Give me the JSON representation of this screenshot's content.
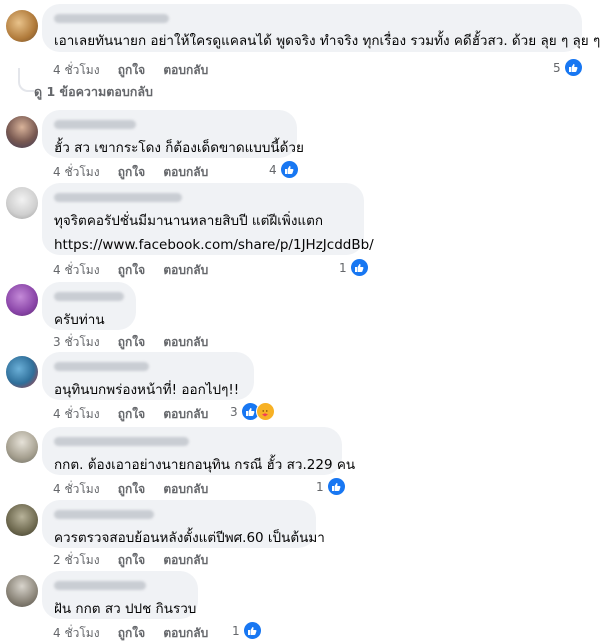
{
  "actions": {
    "like": "ถูกใจ",
    "reply": "ตอบกลับ"
  },
  "colors": {
    "like_blue": "#1877f2",
    "muted": "#65676b",
    "bubble": "#f0f2f5"
  },
  "first": {
    "text": "เอาเลยทันนายก อย่าให้ใครดูแคลนได้ พูดจริง ทำจริง ทุกเรื่อง รวมทั้ง คดีฮั้วสว. ด้วย ลุย ๆ ลุย ๆ",
    "time": "4 ชั่วโมง",
    "reactions": "5",
    "replies_label": "ดู 1 ข้อความตอบกลับ"
  },
  "comments": [
    {
      "text1": "ฮั้ว สว เขากระโดง ก็ต้องเด็ดขาดแบบนี้ด้วย",
      "text2": "",
      "time": "4 ชั่วโมง",
      "reactions": "4"
    },
    {
      "text1": "ทุจริตคอรัปชั่นมีมานานหลายสิบปี แต่ฝีเพิ่งแตก",
      "text2": "https://www.facebook.com/share/p/1JHzJcddBb/",
      "time": "4 ชั่วโมง",
      "reactions": "1"
    },
    {
      "text1": "ครับท่าน",
      "text2": "",
      "time": "3 ชั่วโมง",
      "reactions": ""
    },
    {
      "text1": "อนุทินบกพร่องหน้าที่! ออกไปๆ!!",
      "text2": "",
      "time": "4 ชั่วโมง",
      "reactions": "3"
    },
    {
      "text1": "กกต. ต้องเอาอย่างนายกอนุทิน กรณี ฮั้ว สว.229 คน",
      "text2": "",
      "time": "4 ชั่วโมง",
      "reactions": "1"
    },
    {
      "text1": "ควรตรวจสอบย้อนหลังตั้งแต่ปีพศ.60 เป็นต้นมา",
      "text2": "",
      "time": "2 ชั่วโมง",
      "reactions": ""
    },
    {
      "text1": "ฝัน กกต สว ปปช กินรวบ",
      "text2": "",
      "time": "4 ชั่วโมง",
      "reactions": "1"
    }
  ]
}
